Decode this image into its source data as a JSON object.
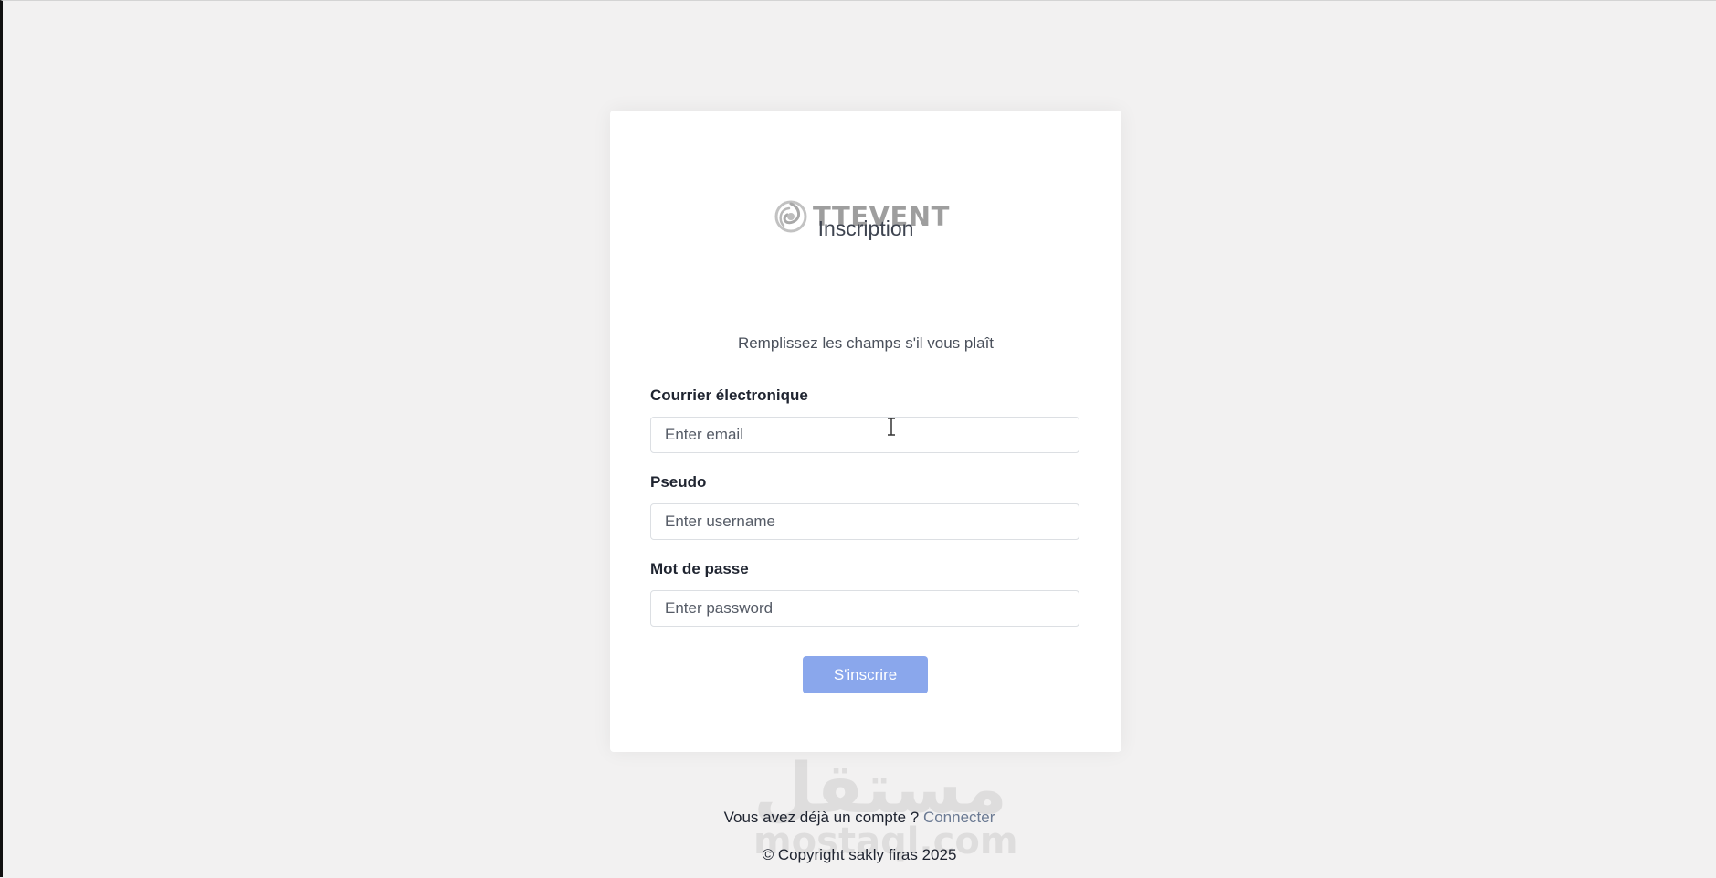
{
  "brand": {
    "name": "TTEVENT",
    "logo_icon": "swirl-logo-icon",
    "color": "#9e9e9e"
  },
  "form": {
    "title": "Inscription",
    "subtitle": "Remplissez les champs s'il vous plaît",
    "email": {
      "label": "Courrier électronique",
      "placeholder": "Enter email",
      "value": ""
    },
    "username": {
      "label": "Pseudo",
      "placeholder": "Enter username",
      "value": ""
    },
    "password": {
      "label": "Mot de passe",
      "placeholder": "Enter password",
      "value": ""
    },
    "submit_label": "S'inscrire",
    "submit_color": "#8aa7ec"
  },
  "footer": {
    "login_prompt": "Vous avez déjà un compte ? ",
    "login_link": "Connecter",
    "copyright": "© Copyright sakly firas 2025"
  },
  "watermark": {
    "arabic": "مستقل",
    "latin": "mostaql.com"
  },
  "pointer": {
    "icon": "text-cursor-icon"
  }
}
